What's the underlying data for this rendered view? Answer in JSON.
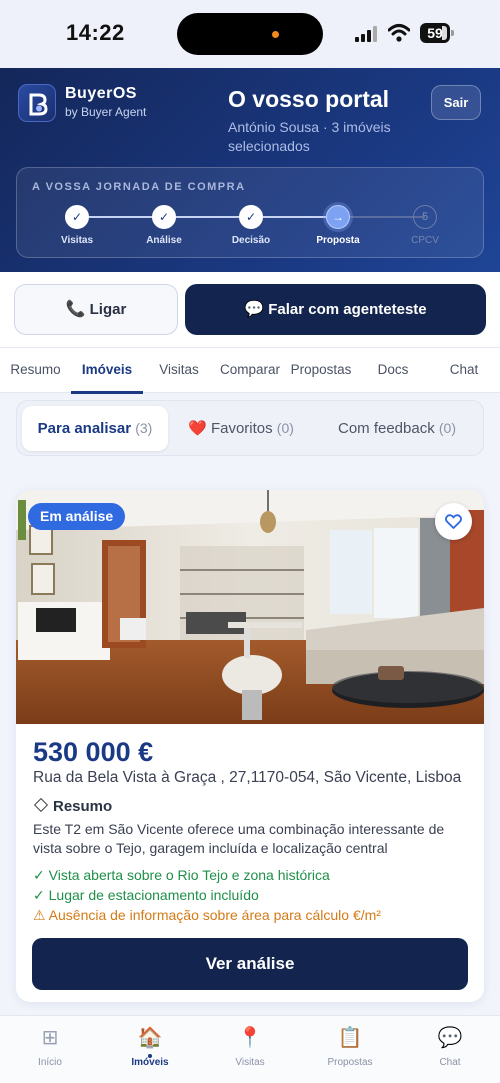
{
  "status_bar": {
    "time": "14:22",
    "battery": "59"
  },
  "header": {
    "brand": "BuyerOS",
    "brand_sub": "by Buyer Agent",
    "title": "O vosso portal",
    "subtitle": "António Sousa · 3 imóveis selecionados",
    "logout_label": "Sair"
  },
  "journey": {
    "title": "A VOSSA JORNADA DE COMPRA",
    "steps": [
      {
        "label": "Visitas",
        "state": "done",
        "mark": "✓"
      },
      {
        "label": "Análise",
        "state": "done",
        "mark": "✓"
      },
      {
        "label": "Decisão",
        "state": "done",
        "mark": "✓"
      },
      {
        "label": "Proposta",
        "state": "current",
        "mark": "→"
      },
      {
        "label": "CPCV",
        "state": "future",
        "mark": "5"
      }
    ]
  },
  "actions": {
    "call_label": "Ligar",
    "agent_label": "Falar com agenteteste"
  },
  "tabs": [
    {
      "label": "Resumo"
    },
    {
      "label": "Imóveis",
      "active": true
    },
    {
      "label": "Visitas"
    },
    {
      "label": "Comparar"
    },
    {
      "label": "Propostas"
    },
    {
      "label": "Docs"
    },
    {
      "label": "Chat"
    }
  ],
  "subtabs": [
    {
      "label": "Para analisar",
      "count": "(3)",
      "active": true
    },
    {
      "label": "Favoritos",
      "count": "(0)"
    },
    {
      "label": "Com feedback",
      "count": "(0)"
    }
  ],
  "property": {
    "status": "Em análise",
    "price": "530 000 €",
    "address": "Rua da Bela Vista à Graça , 27,1170-054, São Vicente, Lisboa",
    "summary_title": "Resumo",
    "summary_text": "Este T2 em São Vicente oferece uma combinação interessante de vista sobre o Tejo, garagem incluída e localização central",
    "points": [
      {
        "text": "✓ Vista aberta sobre o Rio Tejo e zona histórica",
        "kind": "good"
      },
      {
        "text": "✓ Lugar de estacionamento incluído",
        "kind": "good"
      },
      {
        "text": "⚠ Ausência de informação sobre área para cálculo €/m²",
        "kind": "warn"
      }
    ],
    "cta_label": "Ver análise"
  },
  "bottom_nav": [
    {
      "label": "Início",
      "icon": "grid-icon"
    },
    {
      "label": "Imóveis",
      "icon": "house-icon",
      "active": true
    },
    {
      "label": "Visitas",
      "icon": "pin-icon"
    },
    {
      "label": "Propostas",
      "icon": "clipboard-icon"
    },
    {
      "label": "Chat",
      "icon": "chat-bubble-icon"
    }
  ],
  "colors": {
    "primary": "#1b3a85",
    "dark_button": "#13254f",
    "status_pill": "#2f6ae0",
    "good": "#1f8f4a",
    "warn": "#d47a16"
  }
}
